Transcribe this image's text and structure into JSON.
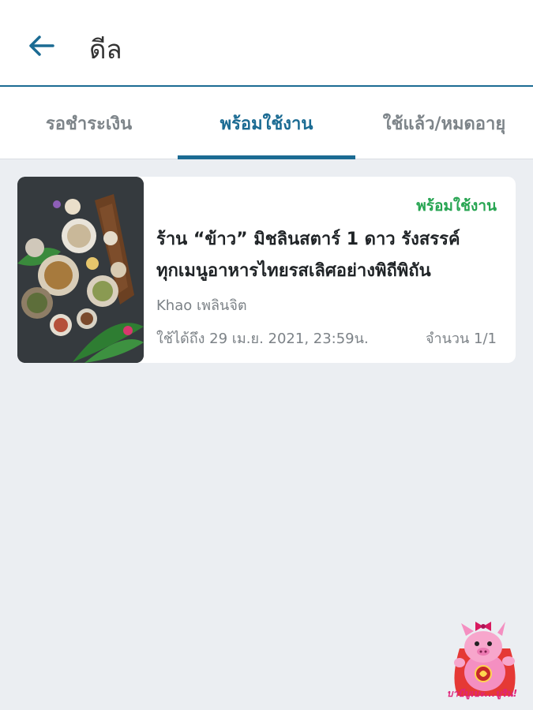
{
  "header": {
    "title": "ดีล"
  },
  "tabs": [
    {
      "label": "รอชำระเงิน"
    },
    {
      "label": "พร้อมใช้งาน"
    },
    {
      "label": "ใช้แล้ว/หมดอายุ"
    }
  ],
  "active_tab_index": 1,
  "deal": {
    "status": "พร้อมใช้งาน",
    "title_line1": "ร้าน “ข้าว” มิชลินสตาร์ 1 ดาว รังสรรค์",
    "title_line2": "ทุกเมนูอาหารไทยรสเลิศอย่างพิถีพิถัน",
    "store": "Khao เพลินจิต",
    "expiry": "ใช้ได้ถึง 29 เม.ย. 2021, 23:59น.",
    "quantity": "จำนวน 1/1"
  },
  "watermark": {
    "caption": "บาบีบูเบะ...บูริน!"
  },
  "colors": {
    "accent": "#1b6b93",
    "status_green": "#27a552",
    "background": "#ebeef2"
  },
  "icons": {
    "back": "arrow-left-icon"
  }
}
